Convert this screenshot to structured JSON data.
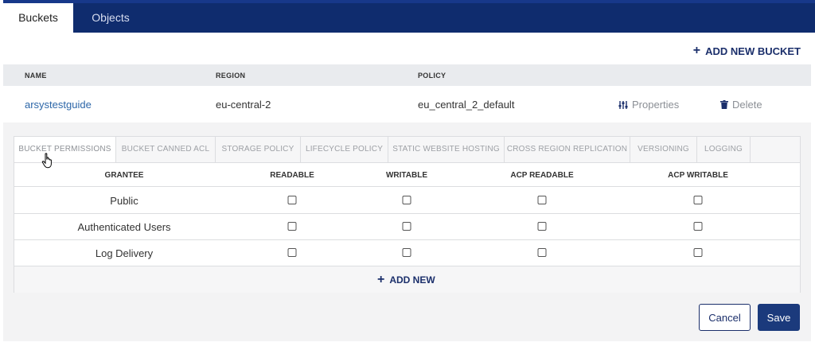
{
  "tabs": [
    {
      "label": "Buckets",
      "active": true
    },
    {
      "label": "Objects",
      "active": false
    }
  ],
  "add_bucket_label": "ADD NEW BUCKET",
  "bucket_table": {
    "headers": {
      "name": "NAME",
      "region": "REGION",
      "policy": "POLICY"
    },
    "rows": [
      {
        "name": "arsystestguide",
        "region": "eu-central-2",
        "policy": "eu_central_2_default",
        "properties_label": "Properties",
        "delete_label": "Delete"
      }
    ]
  },
  "subtabs": [
    "BUCKET PERMISSIONS",
    "BUCKET CANNED ACL",
    "STORAGE POLICY",
    "LIFECYCLE POLICY",
    "STATIC WEBSITE HOSTING",
    "CROSS REGION REPLICATION",
    "VERSIONING",
    "LOGGING"
  ],
  "active_subtab": "BUCKET PERMISSIONS",
  "permissions": {
    "headers": [
      "GRANTEE",
      "READABLE",
      "WRITABLE",
      "ACP READABLE",
      "ACP WRITABLE"
    ],
    "rows": [
      {
        "grantee": "Public",
        "readable": false,
        "writable": false,
        "acp_readable": false,
        "acp_writable": false
      },
      {
        "grantee": "Authenticated Users",
        "readable": false,
        "writable": false,
        "acp_readable": false,
        "acp_writable": false
      },
      {
        "grantee": "Log Delivery",
        "readable": false,
        "writable": false,
        "acp_readable": false,
        "acp_writable": false
      }
    ],
    "add_new_label": "ADD NEW"
  },
  "buttons": {
    "cancel": "Cancel",
    "save": "Save"
  },
  "colors": {
    "navy": "#0f2c6e",
    "accent": "#1b3a7c",
    "link": "#2c66a8"
  },
  "icons": [
    "plus-icon",
    "sliders-icon",
    "trash-icon",
    "pointer-cursor-icon"
  ]
}
